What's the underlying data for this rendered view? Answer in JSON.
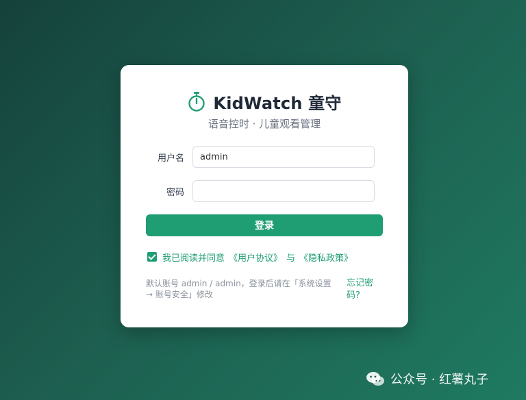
{
  "brand": {
    "title": "KidWatch 童守",
    "subtitle": "语音控时 · 儿童观看管理",
    "icon": "stopwatch-icon",
    "accent_color": "#1f9e74"
  },
  "form": {
    "username_label": "用户名",
    "username_value": "admin",
    "password_label": "密码",
    "password_value": "",
    "login_label": "登录"
  },
  "agreement": {
    "checked": true,
    "prefix": "我已阅读并同意",
    "user_agreement": "《用户协议》",
    "joiner": "与",
    "privacy_policy": "《隐私政策》"
  },
  "footer": {
    "hint": "默认账号 admin / admin，登录后请在「系统设置 → 账号安全」修改",
    "forgot": "忘记密码?"
  },
  "watermark": {
    "text": "公众号 · 红薯丸子",
    "icon": "wechat-icon"
  }
}
